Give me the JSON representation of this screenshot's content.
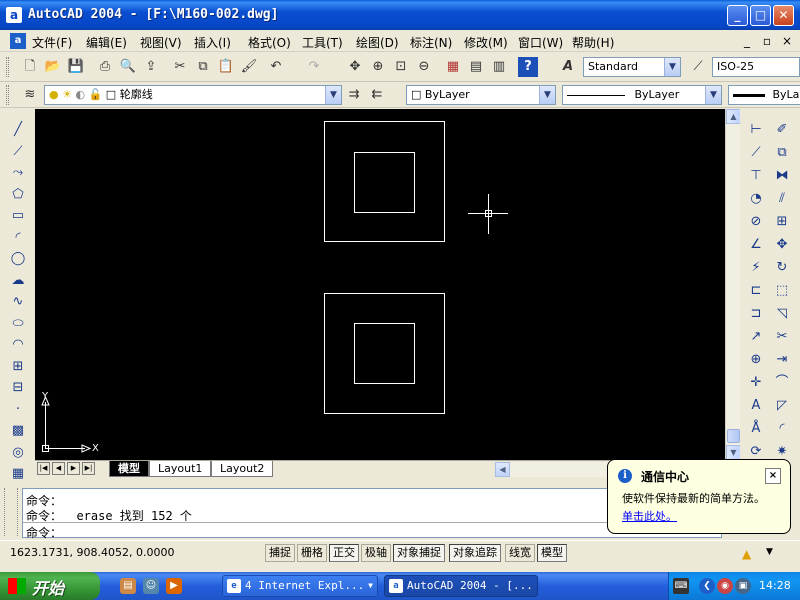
{
  "window": {
    "app_icon": "a",
    "title": "AutoCAD 2004 - [F:\\M160-002.dwg]",
    "min_label": "_",
    "max_label": "□",
    "close_label": "✕"
  },
  "menubar": {
    "doc_icon": "a",
    "items": [
      "文件(F)",
      "编辑(E)",
      "视图(V)",
      "插入(I)",
      "格式(O)",
      "工具(T)",
      "绘图(D)",
      "标注(N)",
      "修改(M)",
      "窗口(W)",
      "帮助(H)"
    ],
    "doc_controls": [
      "_",
      "▫",
      "×"
    ]
  },
  "toolbar_standard": {
    "icons": [
      "new-file-icon",
      "open-file-icon",
      "save-icon",
      "plot-icon",
      "plot-preview-icon",
      "publish-icon",
      "cut-icon",
      "copy-icon",
      "paste-icon",
      "match-properties-icon",
      "undo-icon",
      "redo-icon",
      "pan-icon",
      "zoom-realtime-icon",
      "zoom-window-icon",
      "zoom-previous-icon",
      "properties-icon",
      "design-center-icon",
      "tool-palettes-icon",
      "help-icon"
    ],
    "text_style_icon": "A",
    "text_style": "Standard",
    "dim_style": "ISO-25"
  },
  "toolbar_layers": {
    "layer_name": "轮廓线",
    "color": "ByLayer",
    "linetype": "ByLayer",
    "lineweight": "ByLay"
  },
  "left_tools": [
    "line-icon",
    "construction-line-icon",
    "polyline-icon",
    "polygon-icon",
    "rectangle-icon",
    "arc-icon",
    "circle-icon",
    "revision-cloud-icon",
    "spline-icon",
    "ellipse-icon",
    "ellipse-arc-icon",
    "insert-block-icon",
    "make-block-icon",
    "point-icon",
    "hatch-icon",
    "region-icon",
    "table-icon",
    "multiline-text-icon"
  ],
  "right_tools_col1": [
    "linear-dim-icon",
    "aligned-dim-icon",
    "ordinate-dim-icon",
    "radius-dim-icon",
    "diameter-dim-icon",
    "angular-dim-icon",
    "quick-dim-icon",
    "baseline-dim-icon",
    "continue-dim-icon",
    "leader-icon",
    "tolerance-icon",
    "center-mark-icon",
    "dim-edit-icon",
    "dim-text-edit-icon",
    "dim-update-icon"
  ],
  "right_tools_col2": [
    "erase-icon",
    "copy-object-icon",
    "mirror-icon",
    "offset-icon",
    "array-icon",
    "move-icon",
    "rotate-icon",
    "scale-icon",
    "stretch-icon",
    "trim-icon",
    "extend-icon",
    "break-icon",
    "chamfer-icon",
    "fillet-icon",
    "explode-icon"
  ],
  "canvas": {
    "background": "#000000",
    "ucs_x_label": "X",
    "ucs_y_label": "Y"
  },
  "tabs": {
    "nav": [
      "|◀",
      "◀",
      "▶",
      "▶|"
    ],
    "items": [
      {
        "label": "模型",
        "active": true
      },
      {
        "label": "Layout1",
        "active": false
      },
      {
        "label": "Layout2",
        "active": false
      }
    ]
  },
  "command": {
    "lines": [
      "命令：",
      "命令： _erase 找到 152 个",
      "命令："
    ]
  },
  "status": {
    "coords": "1623.1731, 908.4052, 0.0000",
    "buttons": [
      {
        "label": "捕捉",
        "on": false
      },
      {
        "label": "栅格",
        "on": false
      },
      {
        "label": "正交",
        "on": true
      },
      {
        "label": "极轴",
        "on": false
      },
      {
        "label": "对象捕捉",
        "on": true
      },
      {
        "label": "对象追踪",
        "on": true
      },
      {
        "label": "线宽",
        "on": false
      },
      {
        "label": "模型",
        "on": true
      }
    ]
  },
  "balloon": {
    "title": "通信中心",
    "message": "使软件保持最新的简单方法。",
    "link": "单击此处。",
    "close": "×"
  },
  "taskbar": {
    "start_label": "开始",
    "tasks": [
      {
        "label": "4 Internet Expl...",
        "icon": "e",
        "active": false
      },
      {
        "label": "AutoCAD 2004 - [...",
        "icon": "a",
        "active": true
      }
    ],
    "clock": "14:28"
  }
}
